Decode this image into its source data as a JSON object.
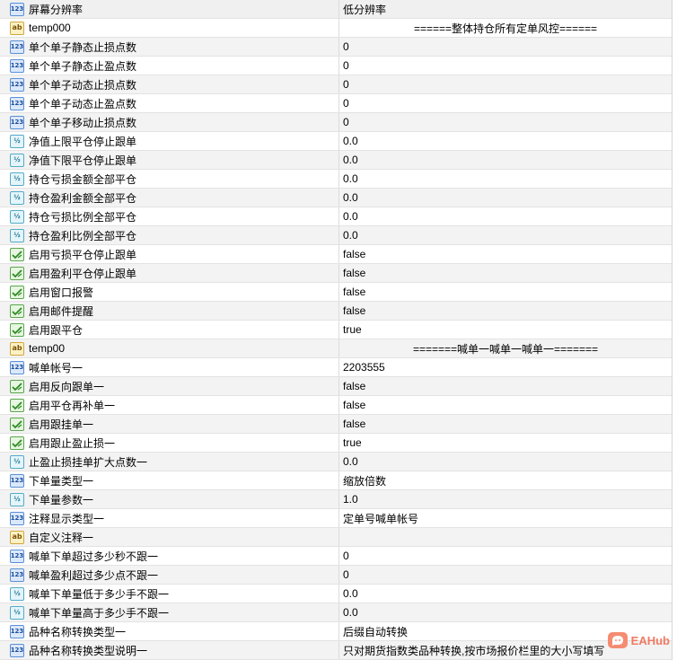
{
  "header": {
    "name": "屏幕分辨率",
    "value": "低分辨率",
    "icon": "integer-type-icon"
  },
  "rows": [
    {
      "type": "string",
      "name": "temp000",
      "value": "======整体持仓所有定单风控======",
      "value_centered": true
    },
    {
      "type": "integer",
      "name": "单个单子静态止损点数",
      "value": "0"
    },
    {
      "type": "integer",
      "name": "单个单子静态止盈点数",
      "value": "0"
    },
    {
      "type": "integer",
      "name": "单个单子动态止损点数",
      "value": "0"
    },
    {
      "type": "integer",
      "name": "单个单子动态止盈点数",
      "value": "0"
    },
    {
      "type": "integer",
      "name": "单个单子移动止损点数",
      "value": "0"
    },
    {
      "type": "double",
      "name": "净值上限平仓停止跟单",
      "value": "0.0"
    },
    {
      "type": "double",
      "name": "净值下限平仓停止跟单",
      "value": "0.0"
    },
    {
      "type": "double",
      "name": "持仓亏损金额全部平仓",
      "value": "0.0"
    },
    {
      "type": "double",
      "name": "持仓盈利金额全部平仓",
      "value": "0.0"
    },
    {
      "type": "double",
      "name": "持仓亏损比例全部平仓",
      "value": "0.0"
    },
    {
      "type": "double",
      "name": "持仓盈利比例全部平仓",
      "value": "0.0"
    },
    {
      "type": "bool",
      "name": "启用亏损平仓停止跟单",
      "value": "false"
    },
    {
      "type": "bool",
      "name": "启用盈利平仓停止跟单",
      "value": "false"
    },
    {
      "type": "bool",
      "name": "启用窗口报警",
      "value": "false"
    },
    {
      "type": "bool",
      "name": "启用邮件提醒",
      "value": "false"
    },
    {
      "type": "bool",
      "name": "启用跟平仓",
      "value": "true"
    },
    {
      "type": "string",
      "name": "temp00",
      "value": "=======喊单一喊单一喊单一=======",
      "value_centered": true
    },
    {
      "type": "integer",
      "name": "喊单帐号一",
      "value": "2203555"
    },
    {
      "type": "bool",
      "name": "启用反向跟单一",
      "value": "false"
    },
    {
      "type": "bool",
      "name": "启用平仓再补单一",
      "value": "false"
    },
    {
      "type": "bool",
      "name": "启用跟挂单一",
      "value": "false"
    },
    {
      "type": "bool",
      "name": "启用跟止盈止损一",
      "value": "true"
    },
    {
      "type": "double",
      "name": "止盈止损挂单扩大点数一",
      "value": "0.0"
    },
    {
      "type": "integer",
      "name": "下单量类型一",
      "value": "缩放倍数"
    },
    {
      "type": "double",
      "name": "下单量参数一",
      "value": "1.0"
    },
    {
      "type": "integer",
      "name": "注释显示类型一",
      "value": "定单号喊单帐号"
    },
    {
      "type": "string",
      "name": "自定义注释一",
      "value": ""
    },
    {
      "type": "integer",
      "name": "喊单下单超过多少秒不跟一",
      "value": "0"
    },
    {
      "type": "integer",
      "name": "喊单盈利超过多少点不跟一",
      "value": "0"
    },
    {
      "type": "double",
      "name": "喊单下单量低于多少手不跟一",
      "value": "0.0"
    },
    {
      "type": "double",
      "name": "喊单下单量高于多少手不跟一",
      "value": "0.0"
    },
    {
      "type": "integer",
      "name": "品种名称转换类型一",
      "value": "后缀自动转换"
    },
    {
      "type": "integer",
      "name": "品种名称转换类型说明一",
      "value": "只对期货指数类品种转换,按市场报价栏里的大小写填写"
    }
  ],
  "icon_labels": {
    "integer": "123",
    "double": "½",
    "string": "ab",
    "bool": "✓"
  },
  "icon_names": {
    "integer": "integer-type-icon",
    "double": "double-type-icon",
    "string": "string-type-icon",
    "bool": "bool-type-icon"
  },
  "watermark": {
    "text": "EAHub",
    "icon": "eahub-logo-icon"
  },
  "colors": {
    "row_alt": "#f3f3f3",
    "grid_line": "#e3e3e3",
    "watermark": "#ef7a62"
  }
}
